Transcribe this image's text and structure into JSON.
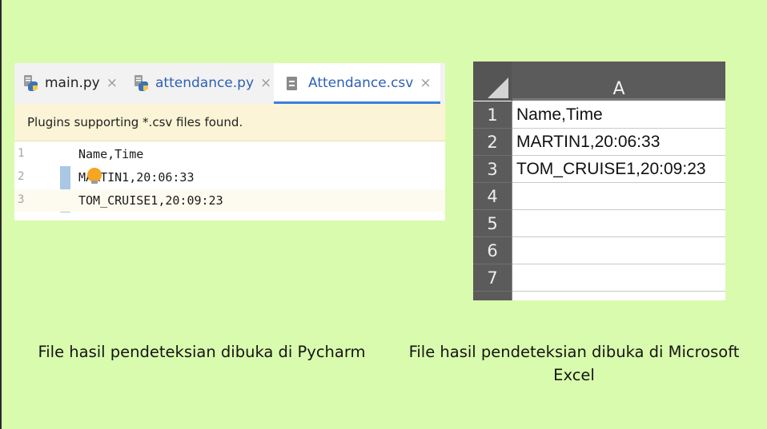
{
  "pycharm": {
    "tabs": [
      {
        "label": "main.py",
        "close": "×"
      },
      {
        "label": "attendance.py",
        "close": "×"
      },
      {
        "label": "Attendance.csv",
        "close": "×"
      }
    ],
    "banner": "Plugins supporting *.csv files found.",
    "lines": [
      {
        "number": "1",
        "text": "Name,Time"
      },
      {
        "number": "2",
        "text": "MARTIN1,20:06:33"
      },
      {
        "number": "3",
        "text": "TOM_CRUISE1,20:09:23"
      }
    ]
  },
  "excel": {
    "column": "A",
    "rows": [
      {
        "number": "1",
        "value": "Name,Time"
      },
      {
        "number": "2",
        "value": "MARTIN1,20:06:33"
      },
      {
        "number": "3",
        "value": "TOM_CRUISE1,20:09:23"
      },
      {
        "number": "4",
        "value": ""
      },
      {
        "number": "5",
        "value": ""
      },
      {
        "number": "6",
        "value": ""
      },
      {
        "number": "7",
        "value": ""
      }
    ]
  },
  "captions": {
    "left": "File hasil pendeteksian dibuka di Pycharm",
    "right_line1": "File hasil pendeteksian dibuka di Microsoft",
    "right_line2": "Excel"
  },
  "colors": {
    "background": "#d9fbad",
    "tab_accent": "#3d7ee0",
    "banner": "#fbf4d6",
    "excel_header": "#5b5b5b"
  }
}
